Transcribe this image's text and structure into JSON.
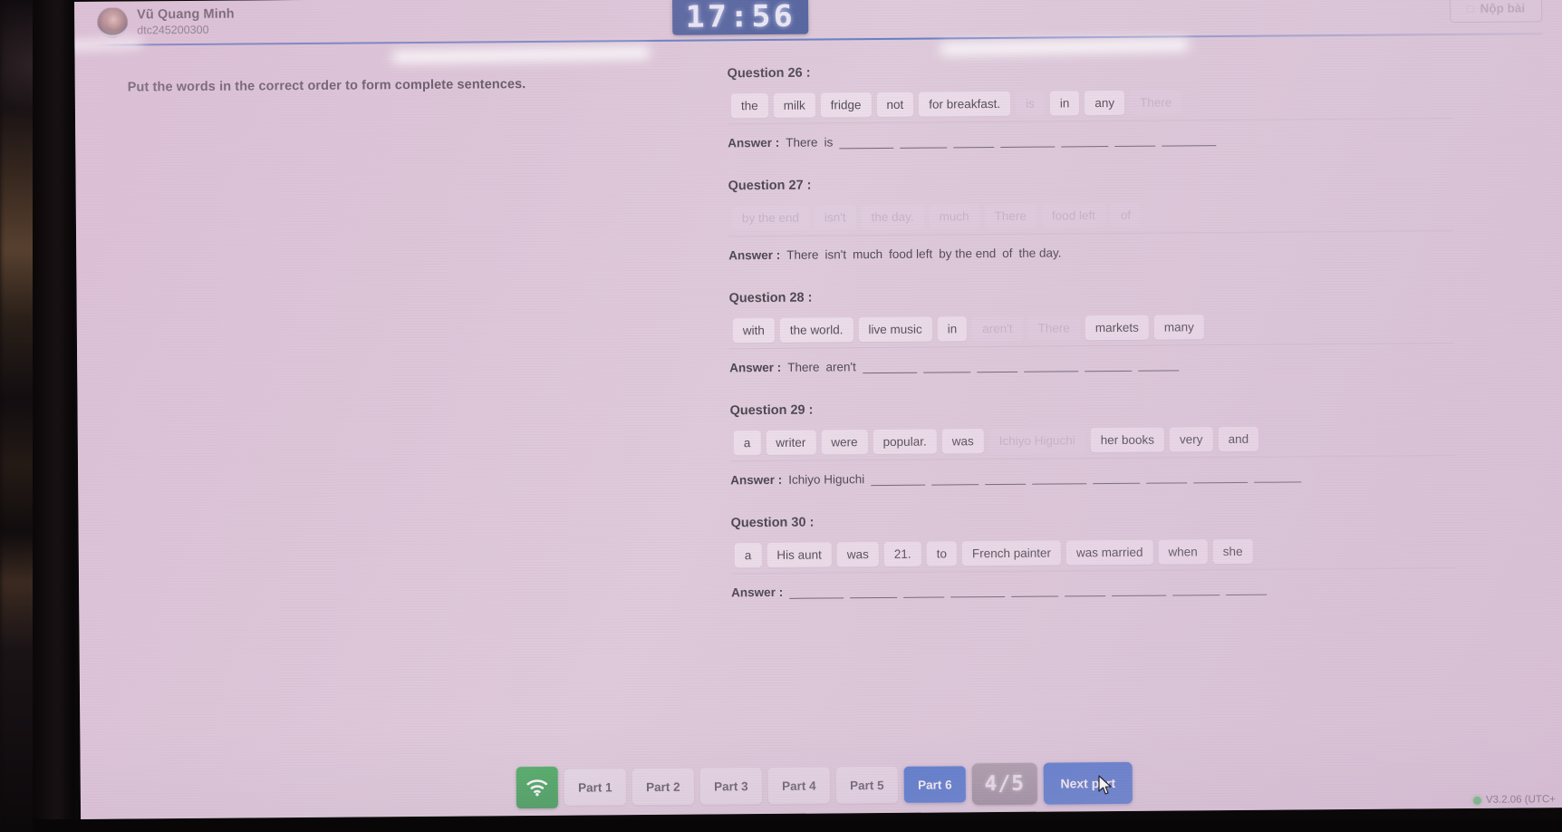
{
  "header": {
    "user_name": "Vũ Quang Minh",
    "user_id": "dtc245200300",
    "timer": "17:56",
    "submit_label": "Nộp bài",
    "submit_icon": "upload-icon"
  },
  "instruction": "Put the words in the correct order to form complete sentences.",
  "questions": [
    {
      "title": "Question 26 :",
      "tiles": [
        {
          "text": "the",
          "used": false
        },
        {
          "text": "milk",
          "used": false
        },
        {
          "text": "fridge",
          "used": false
        },
        {
          "text": "not",
          "used": false
        },
        {
          "text": "for breakfast.",
          "used": false
        },
        {
          "text": "is",
          "used": true
        },
        {
          "text": "in",
          "used": false
        },
        {
          "text": "any",
          "used": false
        },
        {
          "text": "There",
          "used": true
        }
      ],
      "answer_label": "Answer :",
      "answer_words": [
        "There",
        "is"
      ],
      "blanks": 7
    },
    {
      "title": "Question 27 :",
      "tiles": [
        {
          "text": "by the end",
          "used": true
        },
        {
          "text": "isn't",
          "used": true
        },
        {
          "text": "the day.",
          "used": true
        },
        {
          "text": "much",
          "used": true
        },
        {
          "text": "There",
          "used": true
        },
        {
          "text": "food left",
          "used": true
        },
        {
          "text": "of",
          "used": true
        }
      ],
      "answer_label": "Answer :",
      "answer_words": [
        "There",
        "isn't",
        "much",
        "food left",
        "by the end",
        "of",
        "the day."
      ],
      "blanks": 0
    },
    {
      "title": "Question 28 :",
      "tiles": [
        {
          "text": "with",
          "used": false
        },
        {
          "text": "the world.",
          "used": false
        },
        {
          "text": "live music",
          "used": false
        },
        {
          "text": "in",
          "used": false
        },
        {
          "text": "aren't",
          "used": true
        },
        {
          "text": "There",
          "used": true
        },
        {
          "text": "markets",
          "used": false
        },
        {
          "text": "many",
          "used": false
        }
      ],
      "answer_label": "Answer :",
      "answer_words": [
        "There",
        "aren't"
      ],
      "blanks": 6
    },
    {
      "title": "Question 29 :",
      "tiles": [
        {
          "text": "a",
          "used": false
        },
        {
          "text": "writer",
          "used": false
        },
        {
          "text": "were",
          "used": false
        },
        {
          "text": "popular.",
          "used": false
        },
        {
          "text": "was",
          "used": false
        },
        {
          "text": "Ichiyo Higuchi",
          "used": true
        },
        {
          "text": "her books",
          "used": false
        },
        {
          "text": "very",
          "used": false
        },
        {
          "text": "and",
          "used": false
        }
      ],
      "answer_label": "Answer :",
      "answer_words": [
        "Ichiyo Higuchi"
      ],
      "blanks": 8
    },
    {
      "title": "Question 30 :",
      "tiles": [
        {
          "text": "a",
          "used": false
        },
        {
          "text": "His aunt",
          "used": false
        },
        {
          "text": "was",
          "used": false
        },
        {
          "text": "21.",
          "used": false
        },
        {
          "text": "to",
          "used": false
        },
        {
          "text": "French painter",
          "used": false
        },
        {
          "text": "was married",
          "used": false
        },
        {
          "text": "when",
          "used": false
        },
        {
          "text": "she",
          "used": false
        }
      ],
      "answer_label": "Answer :",
      "answer_words": [],
      "blanks": 9
    }
  ],
  "footer": {
    "wifi_icon": "wifi-icon",
    "parts": [
      {
        "label": "Part 1",
        "active": false
      },
      {
        "label": "Part 2",
        "active": false
      },
      {
        "label": "Part 3",
        "active": false
      },
      {
        "label": "Part 4",
        "active": false
      },
      {
        "label": "Part 5",
        "active": false
      },
      {
        "label": "Part 6",
        "active": true
      }
    ],
    "counter": "4/5",
    "next_label": "Next part",
    "version": "V3.2.06 (UTC+"
  },
  "colors": {
    "accent_blue": "#1f56c4",
    "timer_blue": "#1e3a85",
    "wifi_green": "#1f9e3e",
    "status_green": "#25b33d",
    "screen_bg": "#d9c3d5"
  }
}
